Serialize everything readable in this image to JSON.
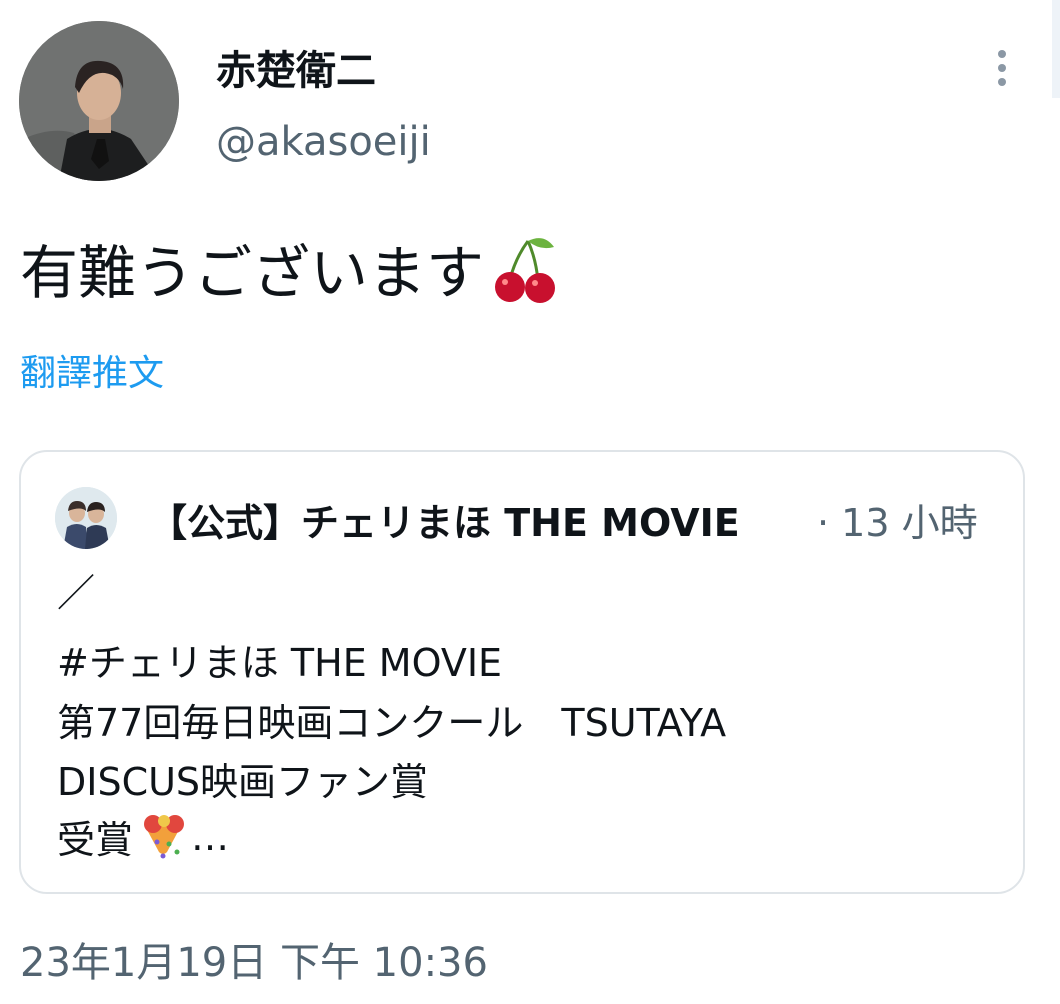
{
  "tweet": {
    "author": {
      "display_name": "赤楚衛二",
      "handle": "@akasoeiji",
      "avatar": "author-avatar"
    },
    "text": "有難うございます",
    "emoji": "cherries-icon",
    "translate_link": "翻譯推文",
    "timestamp": "23年1月19日 下午 10:36"
  },
  "quote": {
    "author_name": "【公式】チェリまほ THE MOVIE",
    "time": "· 13 小時",
    "lines": [
      "／",
      "#チェリまほ THE MOVIE",
      "第77回毎日映画コンクール　TSUTAYA",
      "DISCUS映画ファン賞",
      "受賞"
    ],
    "ellipsis": "…",
    "emoji": "party-popper-icon"
  },
  "colors": {
    "link": "#1d9bf0",
    "secondary_text": "#536471",
    "border": "#dfe4e8"
  }
}
